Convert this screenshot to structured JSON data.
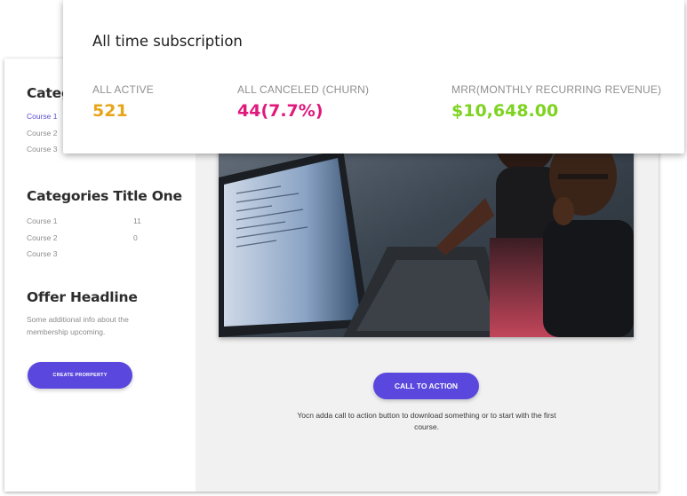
{
  "card": {
    "title": "All time subscription",
    "stats": [
      {
        "label": "ALL ACTIVE",
        "value": "521",
        "color": "#e7a51b"
      },
      {
        "label": "ALL CANCELED (CHURN)",
        "value": "44(7.7%)",
        "color": "#e0197d"
      },
      {
        "label": "MRR(MONTHLY RECURRING REVENUE)",
        "value": "$10,648.00",
        "color": "#7ed321"
      }
    ]
  },
  "sidebar": {
    "section1": {
      "title": "Categ",
      "courses": [
        {
          "label": "Course 1",
          "count": ""
        },
        {
          "label": "Course 2",
          "count": ""
        },
        {
          "label": "Course 3",
          "count": ""
        }
      ]
    },
    "section2": {
      "title": "Categories Title One",
      "courses": [
        {
          "label": "Course 1",
          "count": "11"
        },
        {
          "label": "Course 2",
          "count": "0"
        },
        {
          "label": "Course 3",
          "count": ""
        }
      ]
    },
    "offer": {
      "title": "Offer Headline",
      "text": "Some additional info about the membership upcoming."
    },
    "create_button": "CREATE PRORPERTY"
  },
  "main": {
    "cta_button": "CALL TO ACTION",
    "cta_text": "Yocn adda call to action button to download something or to start with the first course."
  },
  "colors": {
    "accent": "#5a47dd",
    "active_link": "#5b4fd6"
  }
}
